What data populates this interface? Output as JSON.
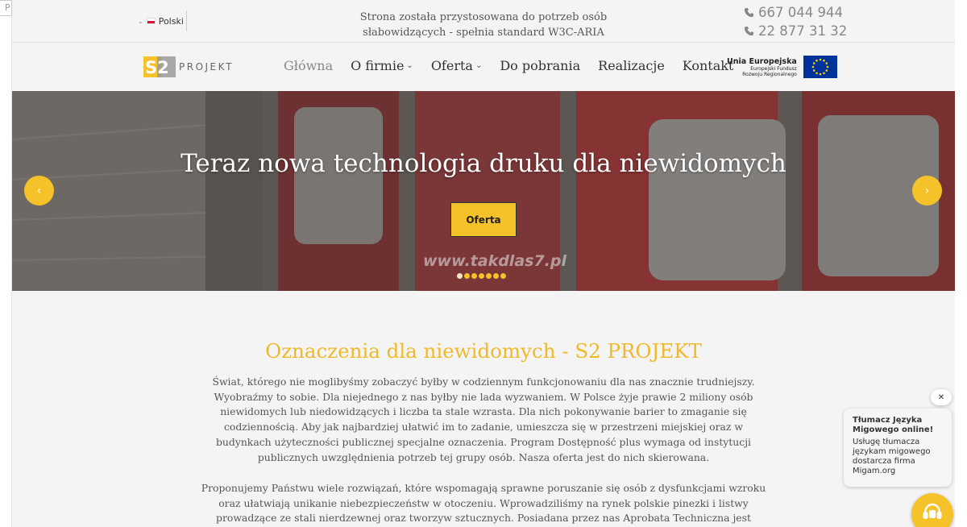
{
  "browser": {
    "left_mark": "P"
  },
  "topbar": {
    "language": "Polski",
    "aria_line1": "Strona została przystosowana do potrzeb osób",
    "aria_line2": "słabowidzących - spełnia standard W3C-ARIA",
    "phone1": "667 044 944",
    "phone2": "22 877 31 32"
  },
  "header": {
    "logo_mark": "S2",
    "logo_text": "PROJEKT",
    "nav": [
      {
        "label": "Główna",
        "dropdown": false,
        "active": true
      },
      {
        "label": "O firmie",
        "dropdown": true,
        "active": false
      },
      {
        "label": "Oferta",
        "dropdown": true,
        "active": false
      },
      {
        "label": "Do pobrania",
        "dropdown": false,
        "active": false
      },
      {
        "label": "Realizacje",
        "dropdown": false,
        "active": false
      },
      {
        "label": "Kontakt",
        "dropdown": false,
        "active": false
      }
    ],
    "eu_title": "Unia Europejska",
    "eu_line1": "Europejski Fundusz",
    "eu_line2": "Rozwoju Regionalnego"
  },
  "slider": {
    "title": "Teraz nowa technologia druku dla niewidomych",
    "button": "Oferta",
    "watermark": "www.takdlas7.pl",
    "slide_count": 7,
    "active_slide": 1
  },
  "content": {
    "heading": "Oznaczenia dla niewidomych - S2 PROJEKT",
    "paragraph1": "Świat, którego nie moglibyśmy zobaczyć byłby w codziennym funkcjonowaniu dla nas znacznie trudniejszy. Wyobraźmy to sobie. Dla niejednego z nas byłby nie lada wyzwaniem. W Polsce żyje prawie 2 miliony osób niewidomych lub niedowidzących i liczba ta stale wzrasta. Dla nich pokonywanie barier to zmaganie się codziennością. Aby jak najbardziej ułatwić im to zadanie, umieszcza się w przestrzeni miejskiej oraz w budynkach użyteczności publicznej specjalne oznaczenia. Program Dostępność plus wymaga od instytucji publicznych uwzględnienia potrzeb tej grupy osób. Nasza oferta jest do nich skierowana.",
    "paragraph2": "Proponujemy Państwu wiele rozwiązań, które wspomagają sprawne poruszanie się osób z dysfunkcjami wzroku oraz ułatwiają unikanie niebezpieczeństw w otoczeniu. Wprowadziliśmy na rynek polskie pinezki i listwy prowadzące ze stali nierdzewnej oraz tworzyw sztucznych. Posiadana przez nas Aprobata Techniczna jest obecnie w Polsce jedynym"
  },
  "chat": {
    "close": "✕",
    "title": "Tłumacz Języka Migowego online!",
    "body": "Usługę tłumacza językam migowego dostarcza firma Migam.org"
  },
  "colors": {
    "accent": "#f5c22a",
    "heading": "#f0b92b",
    "eu_blue": "#003399"
  }
}
